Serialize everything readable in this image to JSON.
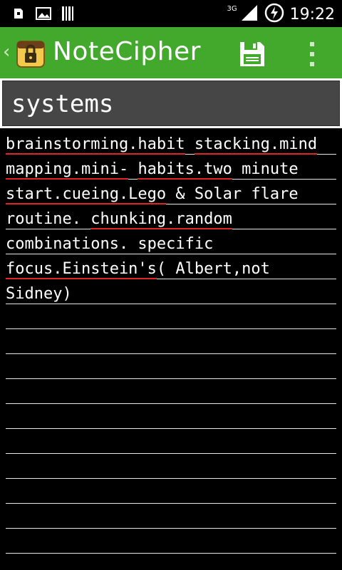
{
  "status_bar": {
    "time": "19:22",
    "network": "3G",
    "icons": [
      "sd-card-icon",
      "image-icon",
      "barcode-icon",
      "signal-icon",
      "battery-charging-icon"
    ]
  },
  "action_bar": {
    "title": "NoteCipher",
    "background": "#43a92d",
    "actions": [
      "save-icon",
      "overflow-menu-icon"
    ]
  },
  "note": {
    "title": "systems",
    "lines": [
      [
        "brainstorming.habit",
        " ",
        "stacking.mind"
      ],
      [
        "mapping.mini-",
        " ",
        "habits.two",
        " minute"
      ],
      [
        "start.cueing.Lego",
        " & Solar flare"
      ],
      [
        "routine.",
        " ",
        "chunking.random"
      ],
      [
        "combinations. specific"
      ],
      [
        "focus.Einstein's",
        "( Albert,not"
      ],
      [
        "Sidney)"
      ]
    ]
  }
}
